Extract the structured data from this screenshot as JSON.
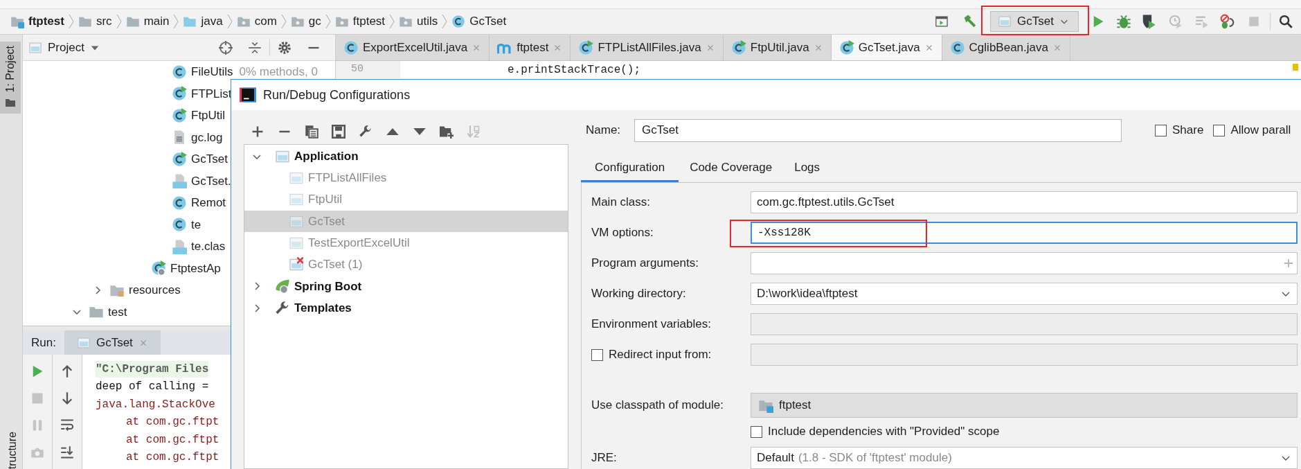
{
  "breadcrumbs": [
    {
      "label": "ftptest",
      "kind": "module"
    },
    {
      "label": "src",
      "kind": "folder"
    },
    {
      "label": "main",
      "kind": "folder"
    },
    {
      "label": "java",
      "kind": "source"
    },
    {
      "label": "com",
      "kind": "package"
    },
    {
      "label": "gc",
      "kind": "package"
    },
    {
      "label": "ftptest",
      "kind": "package"
    },
    {
      "label": "utils",
      "kind": "package"
    },
    {
      "label": "GcTset",
      "kind": "class"
    }
  ],
  "toolbar": {
    "run_configuration": {
      "label": "GcTset",
      "highlighted": true
    }
  },
  "tool_stripe": {
    "top": "1: Project",
    "bottom": "tructure"
  },
  "project_panel": {
    "title": "Project",
    "tree": [
      {
        "children": [
          {
            "children": [
              {
                "children": [
                  {
                    "children": [
                      {
                        "label": "FileUtils",
                        "kind": "class",
                        "hint": "0% methods, 0"
                      },
                      {
                        "label": "FTPList",
                        "kind": "runnable"
                      },
                      {
                        "label": "FtpUtil",
                        "kind": "runnable"
                      },
                      {
                        "label": "gc.log",
                        "kind": "log"
                      },
                      {
                        "label": "GcTset",
                        "kind": "runnable"
                      },
                      {
                        "label": "GcTset.",
                        "kind": "classfile"
                      },
                      {
                        "label": "Remot",
                        "kind": "class"
                      },
                      {
                        "label": "te",
                        "kind": "class"
                      },
                      {
                        "label": "te.clas",
                        "kind": "classfile"
                      }
                    ]
                  },
                  {
                    "label": "FtptestAp",
                    "kind": "spring-app"
                  }
                ]
              }
            ]
          },
          {
            "label": "resources",
            "kind": "resources",
            "expanded": false
          }
        ]
      },
      {
        "label": "test",
        "kind": "folder",
        "expanded": true
      }
    ]
  },
  "editor_tabs": [
    {
      "label": "ExportExcelUtil.java",
      "kind": "class",
      "selected": false
    },
    {
      "label": "ftptest",
      "kind": "maven",
      "selected": false
    },
    {
      "label": "FTPListAllFiles.java",
      "kind": "runnable",
      "selected": false
    },
    {
      "label": "FtpUtil.java",
      "kind": "runnable",
      "selected": false
    },
    {
      "label": "GcTset.java",
      "kind": "runnable",
      "selected": true
    },
    {
      "label": "CglibBean.java",
      "kind": "class",
      "selected": false
    }
  ],
  "editor": {
    "line_number": "50",
    "code": "e.printStackTrace();"
  },
  "run_panel": {
    "label": "Run:",
    "tab": "GcTset",
    "console": [
      {
        "text": "\"C:\\Program Files",
        "kind": "command"
      },
      {
        "text": "deep of calling =",
        "kind": "output"
      },
      {
        "text": "java.lang.StackOve",
        "kind": "error"
      },
      {
        "text": "at com.gc.ftpt",
        "kind": "trace"
      },
      {
        "text": "at com.gc.ftpt",
        "kind": "trace"
      },
      {
        "text": "at com.gc.ftpt",
        "kind": "trace"
      }
    ]
  },
  "dialog": {
    "title": "Run/Debug Configurations",
    "tree": [
      {
        "label": "Application",
        "kind": "application",
        "expanded": true,
        "children": [
          {
            "label": "FTPListAllFiles",
            "kind": "config",
            "selected": false
          },
          {
            "label": "FtpUtil",
            "kind": "config",
            "selected": false
          },
          {
            "label": "GcTset",
            "kind": "config",
            "selected": true
          },
          {
            "label": "TestExportExcelUtil",
            "kind": "config",
            "selected": false
          },
          {
            "label": "GcTset (1)",
            "kind": "config-error",
            "selected": false
          }
        ]
      },
      {
        "label": "Spring Boot",
        "kind": "spring",
        "expanded": false
      },
      {
        "label": "Templates",
        "kind": "templates",
        "expanded": false
      }
    ],
    "name_label": "Name:",
    "name": "GcTset",
    "options": [
      {
        "label": "Share",
        "checked": false
      },
      {
        "label": "Allow parall",
        "checked": false
      }
    ],
    "tabs": [
      {
        "label": "Configuration",
        "selected": true
      },
      {
        "label": "Code Coverage",
        "selected": false
      },
      {
        "label": "Logs",
        "selected": false
      }
    ],
    "fields": [
      {
        "label": "Main class:",
        "kind": "text",
        "value": "com.gc.ftptest.utils.GcTset"
      },
      {
        "label": "VM options:",
        "kind": "code",
        "value": "-Xss128K",
        "focused": true,
        "highlighted": true
      },
      {
        "label": "Program arguments:",
        "kind": "expandable"
      },
      {
        "label": "Working directory:",
        "kind": "dropdown",
        "value": "D:\\work\\idea\\ftptest"
      },
      {
        "label": "Environment variables:",
        "kind": "disabled"
      },
      {
        "label": "Redirect input from:",
        "kind": "checkbox-field",
        "checked": false
      },
      {
        "label": "Use classpath of module:",
        "kind": "module",
        "value": "ftptest"
      },
      {
        "label": "Include dependencies with \"Provided\" scope",
        "kind": "checkbox",
        "checked": false
      },
      {
        "label": "JRE:",
        "kind": "jre",
        "value": "Default",
        "detail": "(1.8 - SDK of 'ftptest' module)"
      }
    ]
  }
}
